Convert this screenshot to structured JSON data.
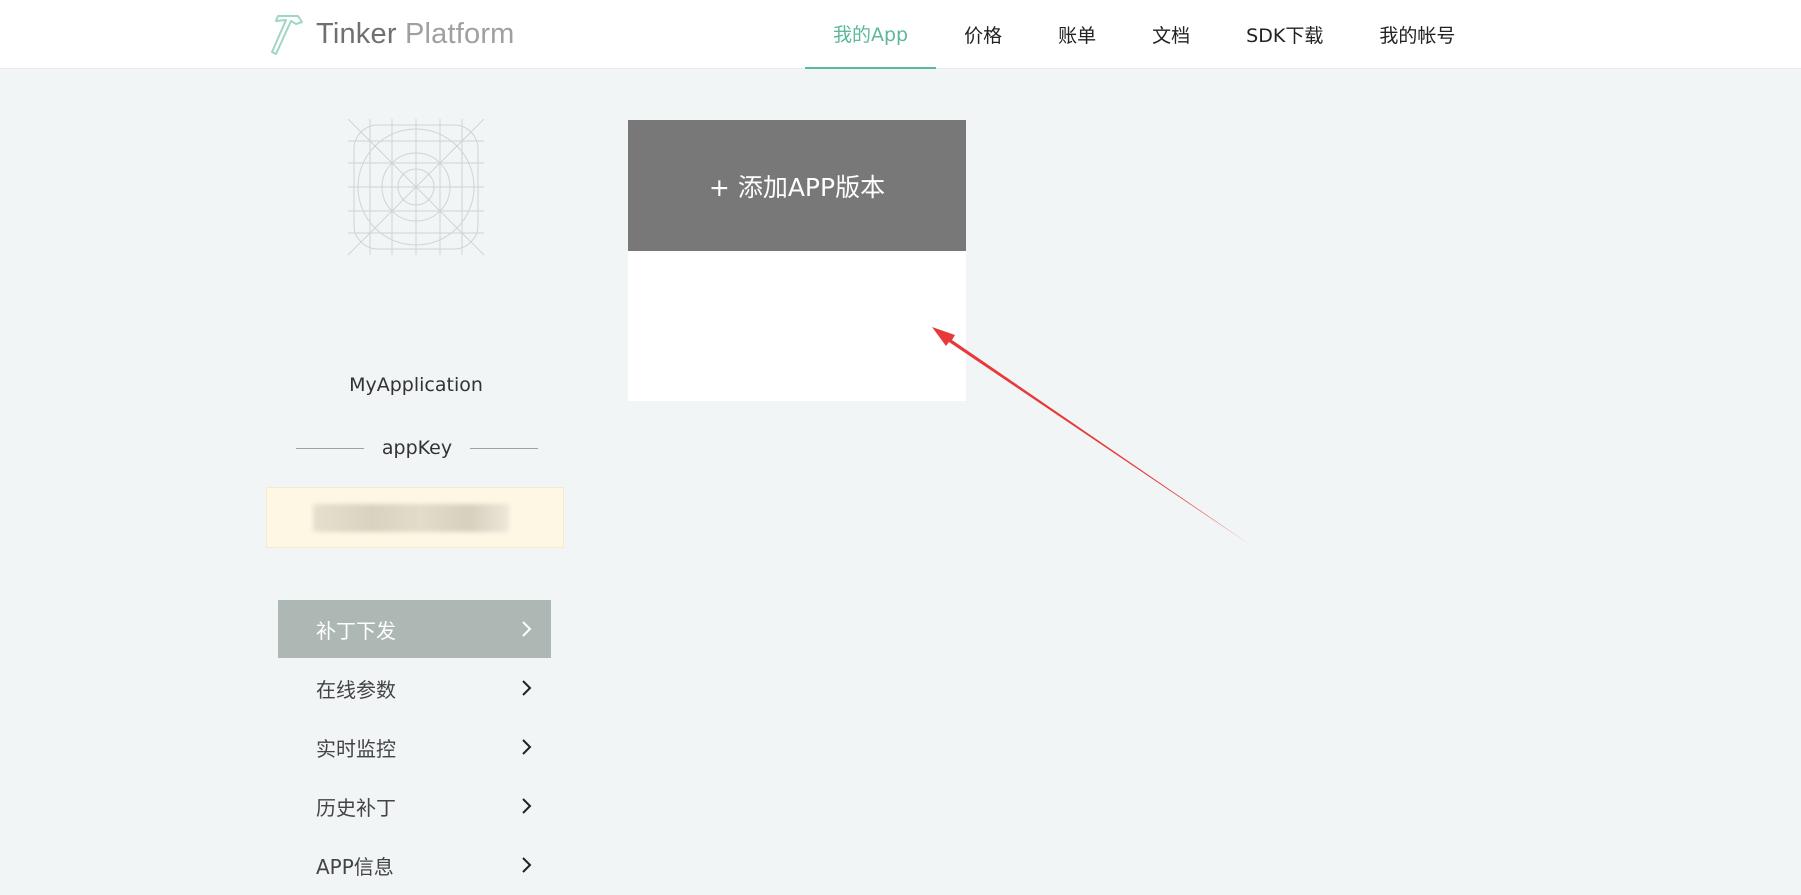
{
  "header": {
    "logo_main": "Tinker",
    "logo_sub": "Platform",
    "nav": [
      {
        "label": "我的App",
        "active": true
      },
      {
        "label": "价格"
      },
      {
        "label": "账单"
      },
      {
        "label": "文档"
      },
      {
        "label": "SDK下载"
      },
      {
        "label": "我的帐号"
      }
    ]
  },
  "sidebar": {
    "app_name": "MyApplication",
    "appkey_label": "appKey",
    "menu": [
      {
        "label": "补丁下发",
        "active": true
      },
      {
        "label": "在线参数"
      },
      {
        "label": "实时监控"
      },
      {
        "label": "历史补丁"
      },
      {
        "label": "APP信息"
      }
    ]
  },
  "main": {
    "add_version_label": "+ 添加APP版本"
  },
  "colors": {
    "accent": "#5cb89a",
    "active_menu_bg": "#adb8b5",
    "add_button_bg": "#787878",
    "annotation_arrow": "#e8393a"
  }
}
